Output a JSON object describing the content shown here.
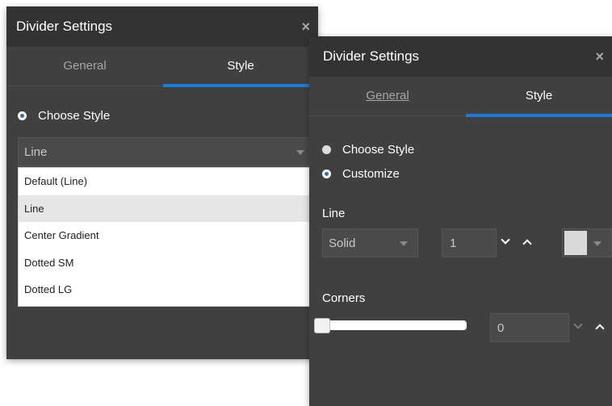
{
  "panel_left": {
    "title": "Divider Settings",
    "close_glyph": "×",
    "tabs": [
      {
        "label": "General",
        "active": false
      },
      {
        "label": "Style",
        "active": true
      }
    ],
    "radio_choose_style": "Choose Style",
    "select_value": "Line",
    "dropdown_options": [
      "Default (Line)",
      "Line",
      "Center Gradient",
      "Dotted SM",
      "Dotted LG"
    ],
    "hovered_option": "Line"
  },
  "panel_right": {
    "title": "Divider Settings",
    "close_glyph": "×",
    "tabs": [
      {
        "label": "General",
        "active": false
      },
      {
        "label": "Style",
        "active": true
      }
    ],
    "radio_choose_style": "Choose Style",
    "radio_customize": "Customize",
    "selected_radio": "Customize",
    "line_label": "Line",
    "line_style_value": "Solid",
    "line_width_value": "1",
    "line_color": "#d9d9d9",
    "corners_label": "Corners",
    "corners_value": "0",
    "corners_slider_level": 0
  },
  "colors": {
    "panel_bg": "#404040",
    "titlebar_bg": "#333333",
    "accent": "#1c7bd4"
  }
}
